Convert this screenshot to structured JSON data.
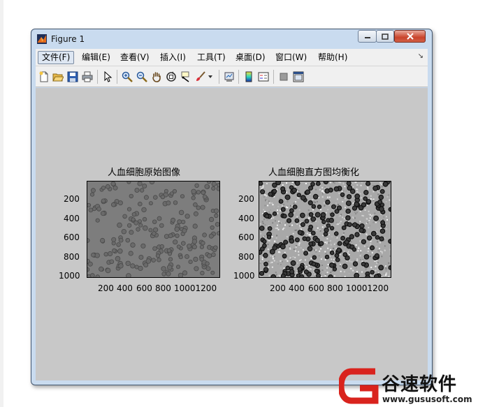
{
  "window": {
    "title": "Figure 1"
  },
  "menu": [
    {
      "label": "文件(F)"
    },
    {
      "label": "编辑(E)"
    },
    {
      "label": "查看(V)"
    },
    {
      "label": "插入(I)"
    },
    {
      "label": "工具(T)"
    },
    {
      "label": "桌面(D)"
    },
    {
      "label": "窗口(W)"
    },
    {
      "label": "帮助(H)"
    }
  ],
  "toolbar": [
    "new-figure-icon",
    "open-icon",
    "save-icon",
    "print-icon",
    "edit-plot-arrow-icon",
    "zoom-in-icon",
    "zoom-out-icon",
    "pan-hand-icon",
    "rotate-3d-icon",
    "data-cursor-icon",
    "brush-icon",
    "link-plot-icon",
    "colorbar-icon",
    "legend-icon",
    "hide-plot-tools-icon",
    "show-plot-tools-icon"
  ],
  "plots": [
    {
      "title": "人血细胞原始图像",
      "y_ticks": [
        "200",
        "400",
        "600",
        "800",
        "1000"
      ],
      "x_ticks": [
        "200",
        "400",
        "600",
        "800",
        "10001200"
      ]
    },
    {
      "title": "人血细胞直方图均衡化",
      "y_ticks": [
        "200",
        "400",
        "600",
        "800",
        "1000"
      ],
      "x_ticks": [
        "200",
        "400",
        "600",
        "800",
        "10001200"
      ]
    }
  ],
  "watermark": {
    "brand": "谷速软件",
    "url": "www.gususoft.com"
  },
  "colors": {
    "figure_bg": "#c8c8c8",
    "menubar_bg": "#f0f0f0",
    "frame": "#c9dbef"
  }
}
